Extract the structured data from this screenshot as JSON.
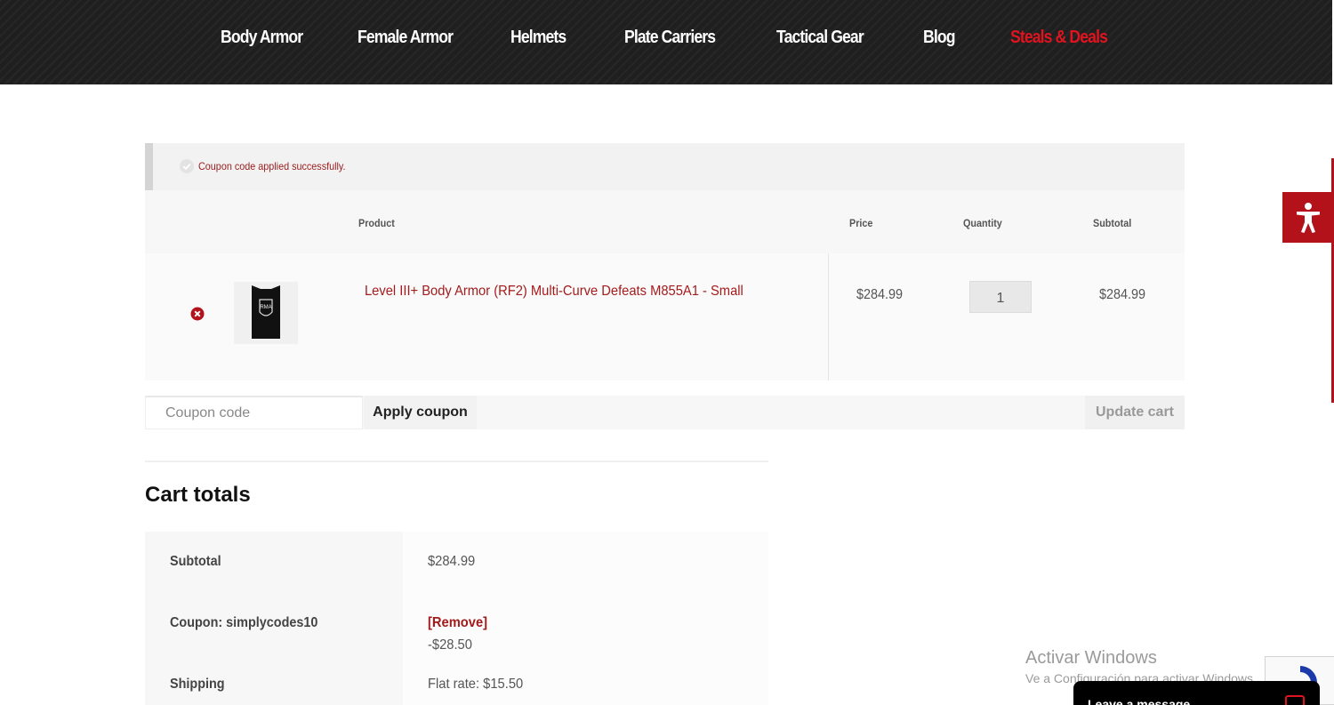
{
  "nav": {
    "items": [
      {
        "label": "Body Armor"
      },
      {
        "label": "Female Armor"
      },
      {
        "label": "Helmets"
      },
      {
        "label": "Plate Carriers"
      },
      {
        "label": "Tactical Gear"
      },
      {
        "label": "Blog"
      },
      {
        "label": "Steals & Deals"
      }
    ]
  },
  "notice": {
    "message": "Coupon code applied successfully."
  },
  "cart": {
    "headers": {
      "product": "Product",
      "price": "Price",
      "quantity": "Quantity",
      "subtotal": "Subtotal"
    },
    "items": [
      {
        "name": "Level III+ Body Armor (RF2) Multi-Curve Defeats M855A1 - Small",
        "price": "$284.99",
        "quantity": "1",
        "subtotal": "$284.99",
        "thumb_text": "RMA"
      }
    ],
    "coupon_placeholder": "Coupon code",
    "apply_label": "Apply coupon",
    "update_label": "Update cart"
  },
  "totals": {
    "title": "Cart totals",
    "subtotal_label": "Subtotal",
    "subtotal_value": "$284.99",
    "coupon_label": "Coupon: simplycodes10",
    "coupon_value": "-$28.50",
    "coupon_remove": "[Remove]",
    "shipping_label": "Shipping",
    "shipping_value": "Flat rate: $15.50"
  },
  "watermark": {
    "title": "Activar Windows",
    "subtitle": "Ve a Configuración para activar Windows."
  },
  "chat": {
    "label": "Leave a message"
  },
  "colors": {
    "accent": "#b3121b",
    "deals": "#e0141e",
    "link": "#a31b1b"
  },
  "icons": {
    "accessibility": "accessibility-icon",
    "notice": "check-circle-icon",
    "remove": "remove-x-icon",
    "chat": "chat-bubble-icon",
    "recaptcha": "recaptcha-icon"
  }
}
